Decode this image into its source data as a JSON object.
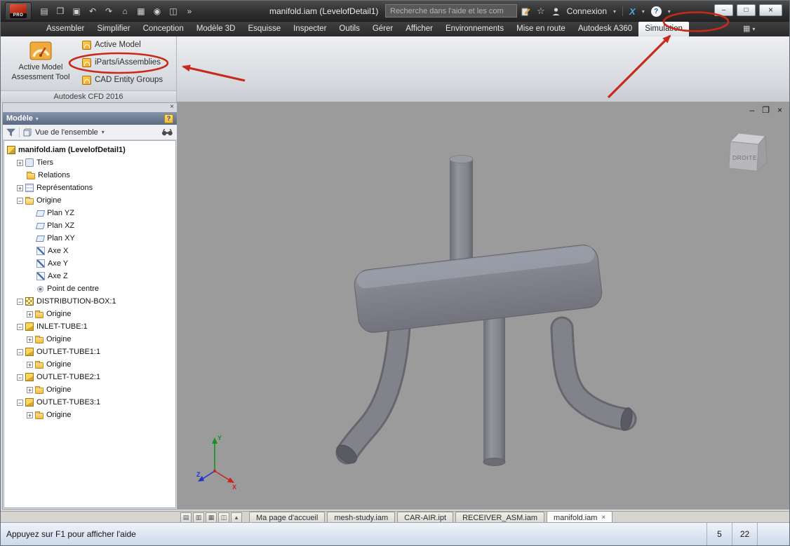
{
  "colors": {
    "annotation": "#c9281b",
    "viewport_bg": "#9b9b9b",
    "axis_x": "#cc2222",
    "axis_y": "#18901f",
    "axis_z": "#2233cc"
  },
  "icons": {
    "caret": "▾",
    "panel_box": "▦"
  },
  "titlebar": {
    "app_badge": "PRO",
    "title": "manifold.iam (LevelofDetail1)",
    "search_placeholder": "Recherche dans l'aide et les com",
    "connexion_label": "Connexion",
    "star_glyph": "☆",
    "autodesk_x": "X",
    "help_glyph": "?",
    "qat": [
      {
        "name": "new-file-icon",
        "glyph": "▤"
      },
      {
        "name": "open-file-icon",
        "glyph": "❒"
      },
      {
        "name": "save-icon",
        "glyph": "▣"
      },
      {
        "name": "undo-icon",
        "glyph": "↶"
      },
      {
        "name": "redo-icon",
        "glyph": "↷"
      },
      {
        "name": "home-icon",
        "glyph": "⌂"
      },
      {
        "name": "view-icon",
        "glyph": "▦"
      },
      {
        "name": "material-icon",
        "glyph": "◉"
      },
      {
        "name": "appearance-icon",
        "glyph": "◫"
      },
      {
        "name": "qat-overflow-icon",
        "glyph": "»"
      }
    ],
    "window_buttons": {
      "minimize": "–",
      "maximize": "□",
      "close": "×"
    }
  },
  "ribbon": {
    "tabs": [
      {
        "label": "Assembler"
      },
      {
        "label": "Simplifier"
      },
      {
        "label": "Conception"
      },
      {
        "label": "Modèle 3D"
      },
      {
        "label": "Esquisse"
      },
      {
        "label": "Inspecter"
      },
      {
        "label": "Outils"
      },
      {
        "label": "Gérer"
      },
      {
        "label": "Afficher"
      },
      {
        "label": "Environnements"
      },
      {
        "label": "Mise en route"
      },
      {
        "label": "Autodesk A360"
      },
      {
        "label": "Simulation",
        "highlighted": true
      }
    ],
    "panel": {
      "big_button": {
        "line1": "Active Model",
        "line2": "Assessment Tool"
      },
      "items": [
        {
          "label": "Active Model",
          "icon": "active-model-icon"
        },
        {
          "label": "iParts/iAssemblies",
          "icon": "iparts-iassemblies-icon"
        },
        {
          "label": "CAD Entity Groups",
          "icon": "cad-entity-groups-icon"
        }
      ],
      "footer": "Autodesk CFD 2016"
    }
  },
  "browser": {
    "title": "Modèle",
    "view_selector": "Vue de l'ensemble",
    "close_glyph": "×",
    "tree": [
      {
        "label": "manifold.iam (LevelofDetail1)",
        "level": 0,
        "icon": "assembly",
        "bold": true
      },
      {
        "label": "Tiers",
        "level": 1,
        "expander": "+",
        "icon": "tiers"
      },
      {
        "label": "Relations",
        "level": 1,
        "icon": "folder"
      },
      {
        "label": "Représentations",
        "level": 1,
        "expander": "+",
        "icon": "representations"
      },
      {
        "label": "Origine",
        "level": 1,
        "expander": "-",
        "icon": "folder-open"
      },
      {
        "label": "Plan YZ",
        "level": 2,
        "icon": "plane"
      },
      {
        "label": "Plan XZ",
        "level": 2,
        "icon": "plane"
      },
      {
        "label": "Plan XY",
        "level": 2,
        "icon": "plane"
      },
      {
        "label": "Axe X",
        "level": 2,
        "icon": "axis"
      },
      {
        "label": "Axe Y",
        "level": 2,
        "icon": "axis"
      },
      {
        "label": "Axe Z",
        "level": 2,
        "icon": "axis"
      },
      {
        "label": "Point de centre",
        "level": 2,
        "icon": "center-point"
      },
      {
        "label": "DISTRIBUTION-BOX:1",
        "level": 1,
        "expander": "-",
        "icon": "part-box"
      },
      {
        "label": "Origine",
        "level": 2,
        "expander": "+",
        "icon": "folder"
      },
      {
        "label": "INLET-TUBE:1",
        "level": 1,
        "expander": "-",
        "icon": "part"
      },
      {
        "label": "Origine",
        "level": 2,
        "expander": "+",
        "icon": "folder"
      },
      {
        "label": "OUTLET-TUBE1:1",
        "level": 1,
        "expander": "-",
        "icon": "part"
      },
      {
        "label": "Origine",
        "level": 2,
        "expander": "+",
        "icon": "folder"
      },
      {
        "label": "OUTLET-TUBE2:1",
        "level": 1,
        "expander": "-",
        "icon": "part"
      },
      {
        "label": "Origine",
        "level": 2,
        "expander": "+",
        "icon": "folder"
      },
      {
        "label": "OUTLET-TUBE3:1",
        "level": 1,
        "expander": "-",
        "icon": "part"
      },
      {
        "label": "Origine",
        "level": 2,
        "expander": "+",
        "icon": "folder"
      }
    ]
  },
  "viewport": {
    "viewcube_label": "DROITE",
    "axis": {
      "x": "X",
      "y": "Y",
      "z": "Z"
    },
    "window_controls": {
      "minimize": "–",
      "restore": "❐",
      "close": "×"
    }
  },
  "docbar": {
    "layout_buttons": [
      {
        "name": "arrange-tile-icon",
        "glyph": "▤"
      },
      {
        "name": "arrange-columns-icon",
        "glyph": "▥"
      },
      {
        "name": "arrange-grid-icon",
        "glyph": "▦"
      },
      {
        "name": "arrange-split-icon",
        "glyph": "◫"
      }
    ],
    "collapse_button_glyph": "▴",
    "tabs": [
      {
        "label": "Ma page d'accueil"
      },
      {
        "label": "mesh-study.iam"
      },
      {
        "label": "CAR-AIR.ipt"
      },
      {
        "label": "RECEIVER_ASM.iam"
      },
      {
        "label": "manifold.iam",
        "active": true,
        "close_glyph": "×"
      }
    ]
  },
  "statusbar": {
    "message": "Appuyez sur F1 pour afficher l'aide",
    "counters": [
      "5",
      "22"
    ]
  }
}
